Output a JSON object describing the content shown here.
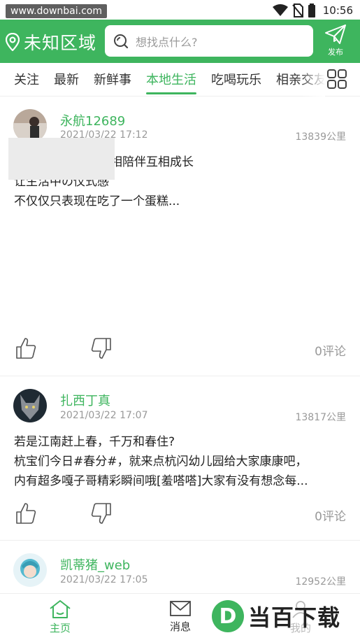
{
  "status_bar": {
    "watermark": "www.downbai.com",
    "time": "10:56",
    "icons": [
      "wifi-icon",
      "no-sim-icon",
      "battery-icon"
    ]
  },
  "header": {
    "location": "未知区域",
    "search_placeholder": "想找点什么?",
    "publish_label": "发布"
  },
  "tabs": {
    "items": [
      "关注",
      "最新",
      "新鲜事",
      "本地生活",
      "吃喝玩乐",
      "相亲交友"
    ],
    "active_index": 3
  },
  "posts": [
    {
      "username": "永航12689",
      "date": "2021/03/22 17:12",
      "distance": "13839公里",
      "lines": [
        "相陪伴互相成长",
        "让生活中の仪式感",
        "不仅仅只表现在吃了一个蛋糕..."
      ],
      "comments": "0评论"
    },
    {
      "username": "扎西丁真",
      "date": "2021/03/22 17:07",
      "distance": "13817公里",
      "lines": [
        "若是江南赶上春，千万和春住?",
        "杭宝们今日#春分#，就来点杭闪幼儿园给大家康康吧，",
        "内有超多嘎子哥精彩瞬间哦[羞嗒嗒]大家有没有想念每..."
      ],
      "comments": "0评论"
    },
    {
      "username": "凯蒂猪_web",
      "date": "2021/03/22 17:05",
      "distance": "12952公里"
    }
  ],
  "bottom_nav": {
    "home": "主页",
    "messages": "消息",
    "mine": "我的"
  },
  "watermark_logo": {
    "letter": "D",
    "text": "当百下载"
  },
  "colors": {
    "brand_green": "#3eb55e",
    "muted_text": "#999999"
  }
}
